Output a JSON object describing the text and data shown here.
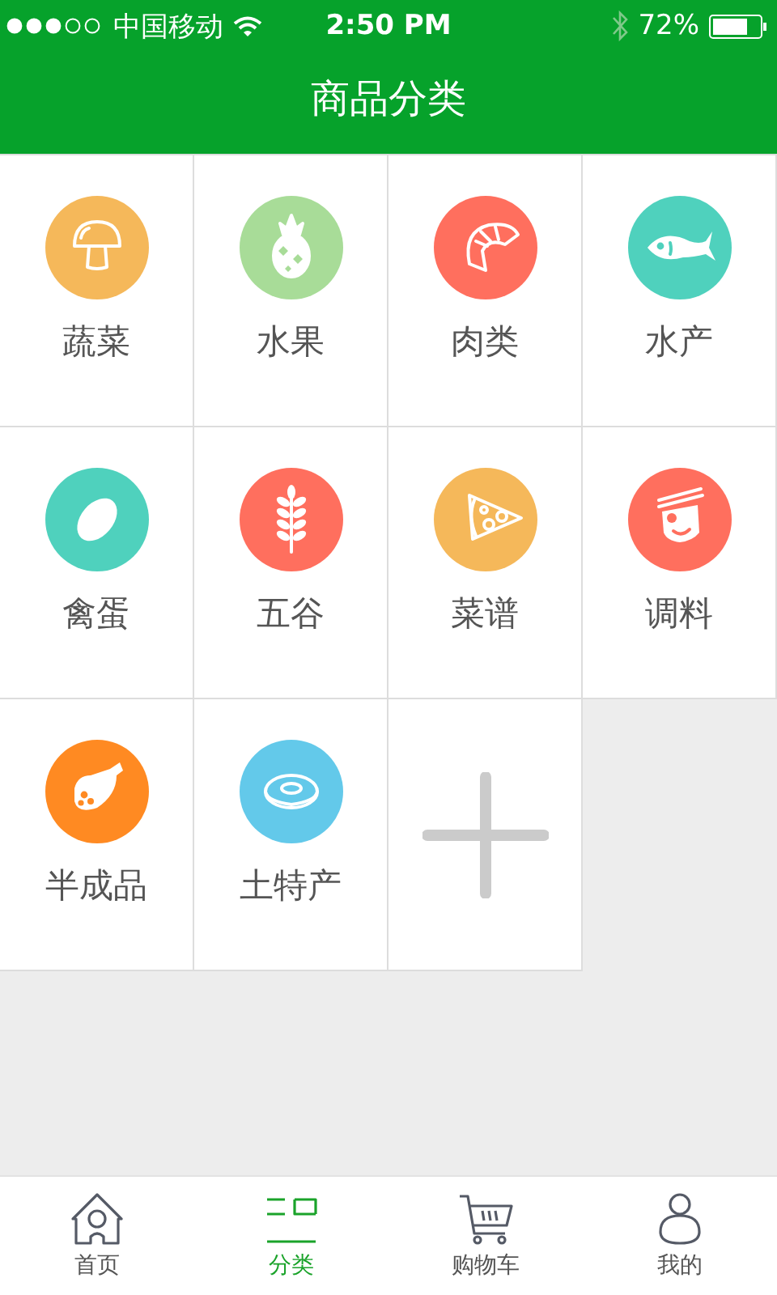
{
  "status_bar": {
    "carrier": "中国移动",
    "time": "2:50 PM",
    "battery": "72%"
  },
  "header": {
    "title": "商品分类"
  },
  "categories": [
    {
      "label": "蔬菜",
      "kind": "mushroom",
      "color": "#f5b85a"
    },
    {
      "label": "水果",
      "kind": "pineapple",
      "color": "#a8dc98"
    },
    {
      "label": "肉类",
      "kind": "shrimp",
      "color": "#ff6f5e"
    },
    {
      "label": "水产",
      "kind": "fish",
      "color": "#4fd1bd"
    },
    {
      "label": "禽蛋",
      "kind": "egg",
      "color": "#4fd1bd"
    },
    {
      "label": "五谷",
      "kind": "wheat",
      "color": "#ff6f5e"
    },
    {
      "label": "菜谱",
      "kind": "pizza",
      "color": "#f5b85a"
    },
    {
      "label": "调料",
      "kind": "chef",
      "color": "#ff6f5e"
    },
    {
      "label": "半成品",
      "kind": "sausage",
      "color": "#ff8a22"
    },
    {
      "label": "土特产",
      "kind": "donut",
      "color": "#63c9ea"
    }
  ],
  "add_tile": true,
  "tabs": [
    {
      "label": "首页",
      "kind": "home",
      "selected": false
    },
    {
      "label": "分类",
      "kind": "category",
      "selected": true
    },
    {
      "label": "购物车",
      "kind": "cart",
      "selected": false
    },
    {
      "label": "我的",
      "kind": "person",
      "selected": false
    }
  ]
}
